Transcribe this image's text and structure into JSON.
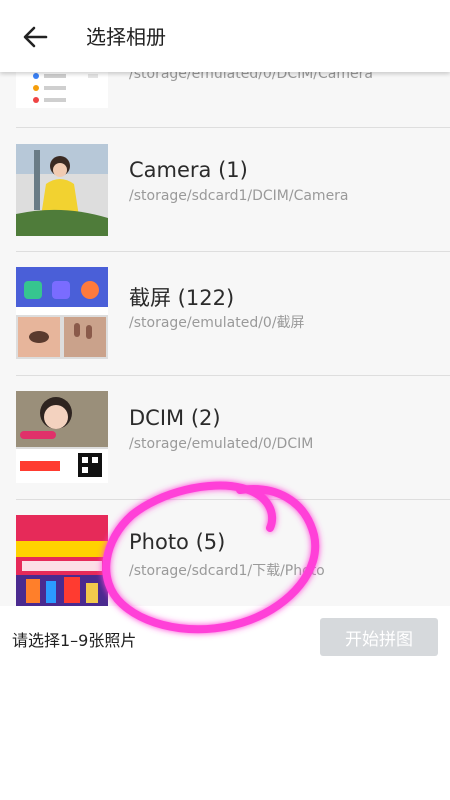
{
  "header": {
    "title": "选择相册",
    "back_icon": "arrow-left-icon"
  },
  "albums": [
    {
      "title": "",
      "path": "/storage/emulated/0/DCIM/Camera"
    },
    {
      "title": "Camera (1)",
      "path": "/storage/sdcard1/DCIM/Camera"
    },
    {
      "title": "截屏 (122)",
      "path": "/storage/emulated/0/截屏"
    },
    {
      "title": "DCIM (2)",
      "path": "/storage/emulated/0/DCIM"
    },
    {
      "title": "Photo (5)",
      "path": "/storage/sdcard1/下载/Photo"
    }
  ],
  "footer": {
    "hint": "请选择1–9张照片",
    "start_button": "开始拼图"
  },
  "colors": {
    "annotation": "#ff3fd8",
    "button_disabled": "#d6d9dc"
  }
}
